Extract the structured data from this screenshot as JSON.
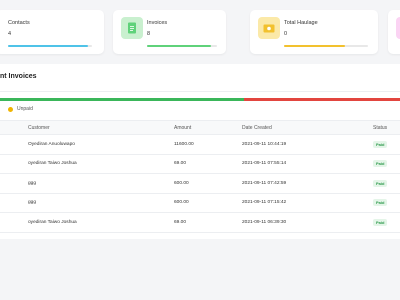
{
  "cards": [
    {
      "label": "Contacts",
      "value": "4",
      "icon": "contacts-icon",
      "accent": "#4fc3e8",
      "progress": 0.95
    },
    {
      "label": "Invoices",
      "value": "8",
      "icon": "document-icon",
      "accent": "#5fd27a",
      "progress": 0.92
    },
    {
      "label": "Total Haulage",
      "value": "0",
      "icon": "money-icon",
      "accent": "#f2c12e",
      "progress": 0.73
    },
    {
      "label": "",
      "value": "",
      "icon": "partial-card-icon",
      "accent": "#f06bd8",
      "progress": 0
    }
  ],
  "panel": {
    "title": "nt Invoices",
    "status_split": {
      "paid": 0.61,
      "unpaid": 0.39
    },
    "legend_label": "Unpaid",
    "columns": [
      "Customer",
      "Amount",
      "Date Created",
      "Status"
    ],
    "rows": [
      {
        "customer": "Oyediran Anuoluwapo",
        "amount": "11600.00",
        "date": "2021-09-11 10:44:19",
        "status": "Paid"
      },
      {
        "customer": "oyediran Taiwo Joshua",
        "amount": "69.00",
        "date": "2021-09-11 07:55:14",
        "status": "Paid"
      },
      {
        "customer": "ggg",
        "amount": "600.00",
        "date": "2021-09-11 07:42:59",
        "status": "Paid"
      },
      {
        "customer": "ggg",
        "amount": "600.00",
        "date": "2021-09-11 07:15:42",
        "status": "Paid"
      },
      {
        "customer": "oyediran Taiwo Joshua",
        "amount": "69.00",
        "date": "2021-09-11 06:39:30",
        "status": "Paid"
      }
    ]
  }
}
